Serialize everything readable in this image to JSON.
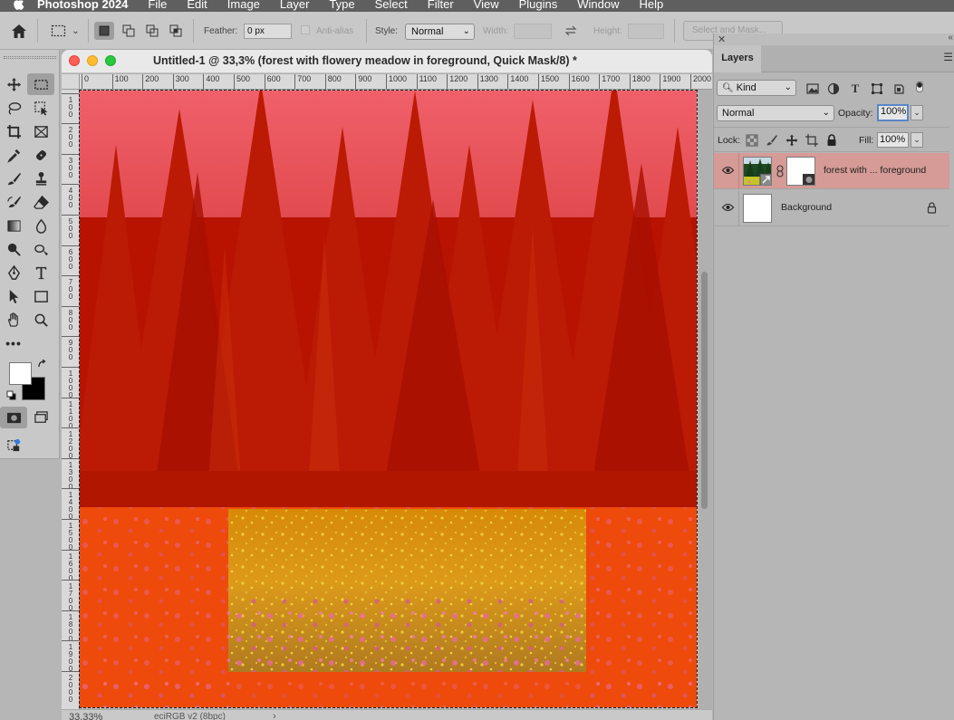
{
  "menubar": {
    "app_name": "Photoshop 2024",
    "items": [
      "File",
      "Edit",
      "Image",
      "Layer",
      "Type",
      "Select",
      "Filter",
      "View",
      "Plugins",
      "Window",
      "Help"
    ]
  },
  "options_bar": {
    "feather_label": "Feather:",
    "feather_value": "0 px",
    "anti_alias_label": "Anti-alias",
    "style_label": "Style:",
    "style_value": "Normal",
    "width_label": "Width:",
    "height_label": "Height:",
    "select_mask_label": "Select and Mask..."
  },
  "document": {
    "title": "Untitled-1 @ 33,3% (forest with flowery meadow in foreground, Quick Mask/8) *",
    "zoom": "33.33%",
    "profile": "eciRGB v2 (8bpc)",
    "ruler_h_labels": [
      "0",
      "100",
      "200",
      "300",
      "400",
      "500",
      "600",
      "700",
      "800",
      "900",
      "1000",
      "1100",
      "1200",
      "1300",
      "1400",
      "1500",
      "1600",
      "1700",
      "1800",
      "1900",
      "2000"
    ],
    "ruler_v_labels": [
      "100",
      "200",
      "300",
      "400",
      "500",
      "600",
      "700",
      "800",
      "900",
      "1000",
      "1100",
      "1200",
      "1300",
      "1400",
      "1500",
      "1600",
      "1700",
      "1800",
      "1900",
      "2000"
    ],
    "quick_mask_color": "#ff2a1a"
  },
  "layers_panel": {
    "tab_label": "Layers",
    "filter_kind": "Kind",
    "blend_mode": "Normal",
    "opacity_label": "Opacity:",
    "opacity_value": "100%",
    "lock_label": "Lock:",
    "fill_label": "Fill:",
    "fill_value": "100%",
    "layers": [
      {
        "name": "forest with ... foreground",
        "selected": true,
        "has_mask": true
      },
      {
        "name": "Background",
        "selected": false,
        "locked": true
      }
    ],
    "selected_color": "#d69b97"
  },
  "tools": [
    "move-tool",
    "marquee-tool",
    "lasso-tool",
    "object-selection-tool",
    "crop-tool",
    "frame-tool",
    "eyedropper-tool",
    "spot-healing-tool",
    "brush-tool",
    "clone-stamp-tool",
    "history-brush-tool",
    "eraser-tool",
    "gradient-tool",
    "blur-tool",
    "dodge-tool",
    "smudge-tool",
    "pen-tool",
    "type-tool",
    "path-selection-tool",
    "rectangle-tool",
    "hand-tool",
    "zoom-tool",
    "more-tools",
    "quick-mask-mode",
    "screen-mode"
  ]
}
